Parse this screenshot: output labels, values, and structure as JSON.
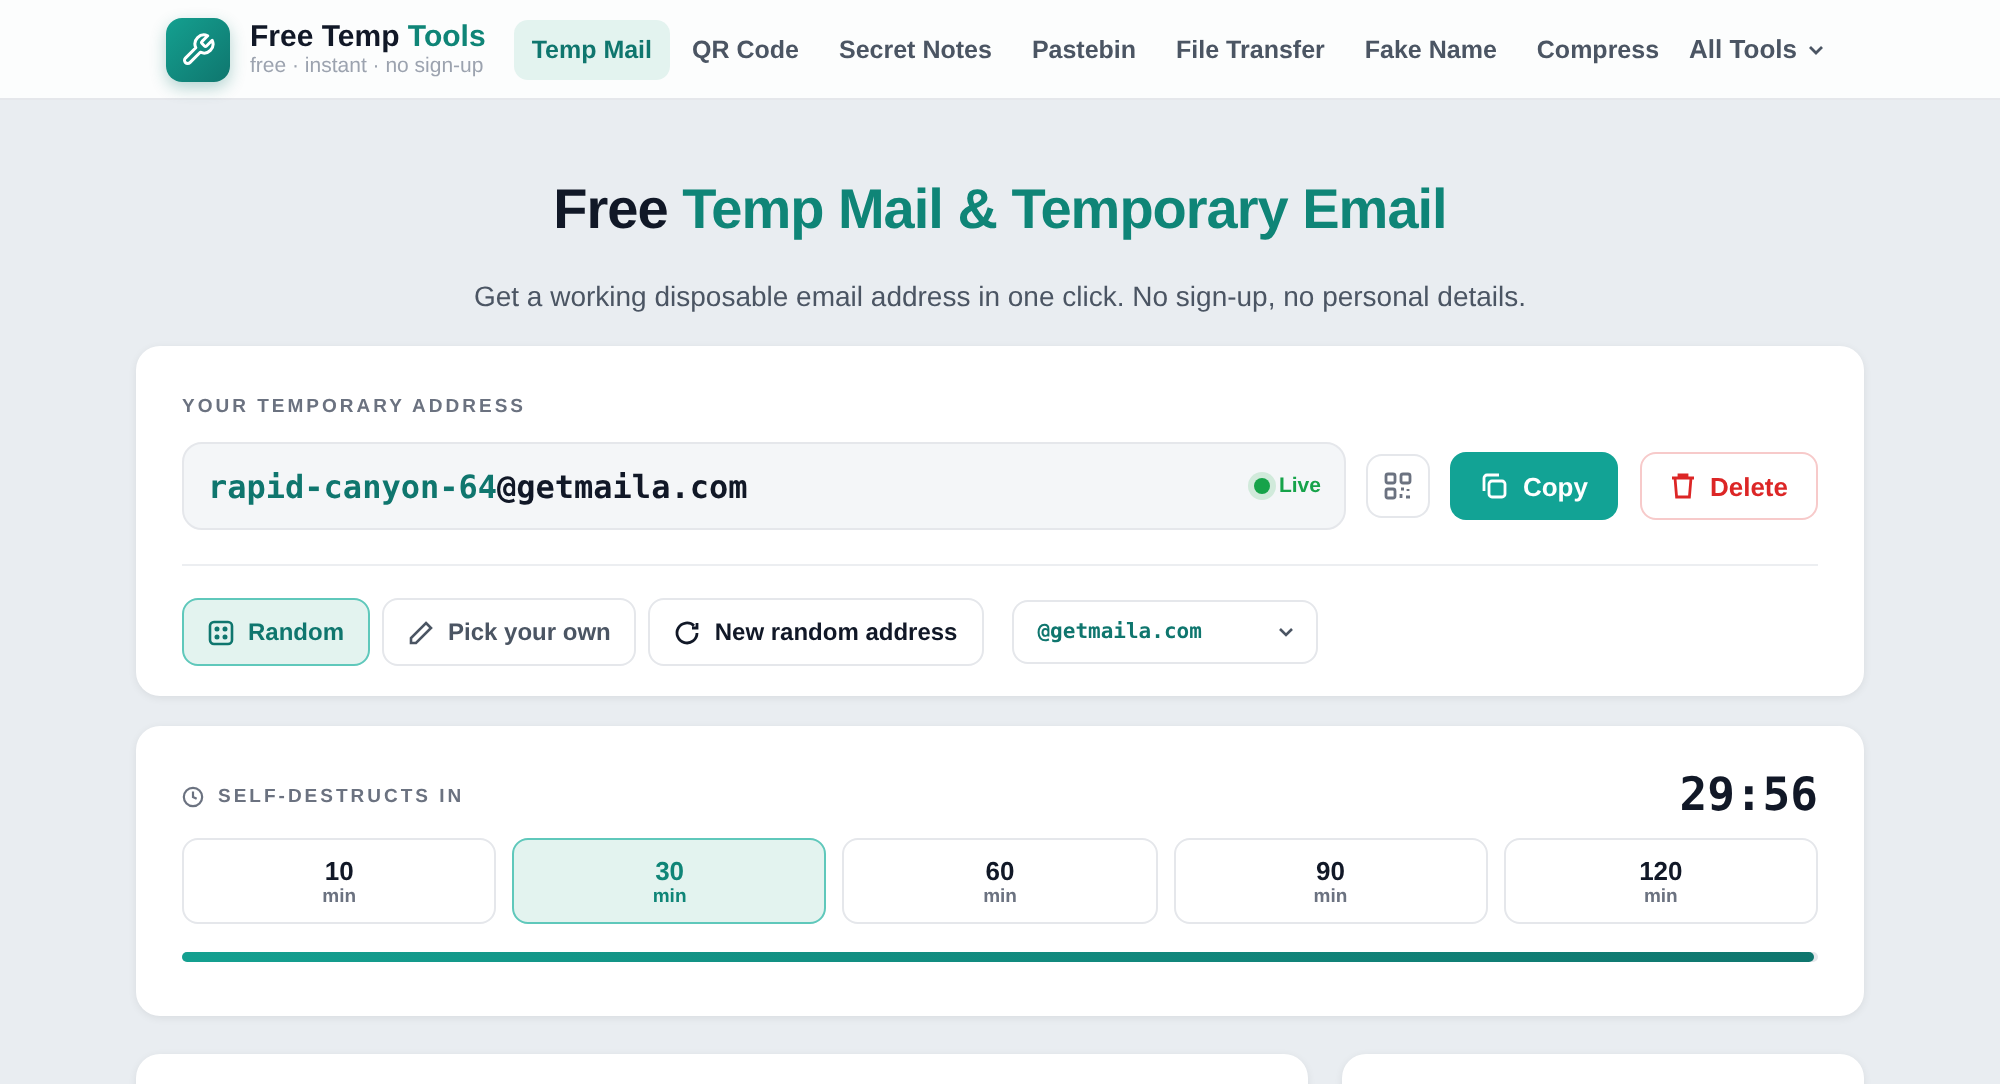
{
  "brand": {
    "name": "Free Temp",
    "name_accent": "Tools",
    "tagline": "free · instant · no sign-up"
  },
  "nav": [
    {
      "label": "Temp Mail",
      "selected": true
    },
    {
      "label": "QR Code",
      "selected": false
    },
    {
      "label": "Secret Notes",
      "selected": false
    },
    {
      "label": "Pastebin",
      "selected": false
    },
    {
      "label": "File Transfer",
      "selected": false
    },
    {
      "label": "Fake Name",
      "selected": false
    },
    {
      "label": "Compress",
      "selected": false
    }
  ],
  "all_tools": "All Tools",
  "hero": {
    "title": "Free",
    "title_accent": "Temp Mail & Temporary Email",
    "subtitle": "Get a working disposable email address in one click. No sign-up, no personal details."
  },
  "address_card": {
    "label": "YOUR TEMPORARY ADDRESS",
    "local_part": "rapid-canyon-64",
    "domain": "@getmaila.com",
    "status": "Live",
    "copy": "Copy",
    "delete": "Delete",
    "modes": [
      {
        "label": "Random",
        "selected": true
      },
      {
        "label": "Pick your own",
        "selected": false
      }
    ],
    "new_random": "New random address",
    "domain_select": "@getmaila.com"
  },
  "timer_card": {
    "label": "SELF-DESTRUCTS IN",
    "countdown": "29:56",
    "durations": [
      {
        "value": "10",
        "unit": "min",
        "selected": false
      },
      {
        "value": "30",
        "unit": "min",
        "selected": true
      },
      {
        "value": "60",
        "unit": "min",
        "selected": false
      },
      {
        "value": "90",
        "unit": "min",
        "selected": false
      },
      {
        "value": "120",
        "unit": "min",
        "selected": false
      }
    ],
    "level": 0.998
  }
}
